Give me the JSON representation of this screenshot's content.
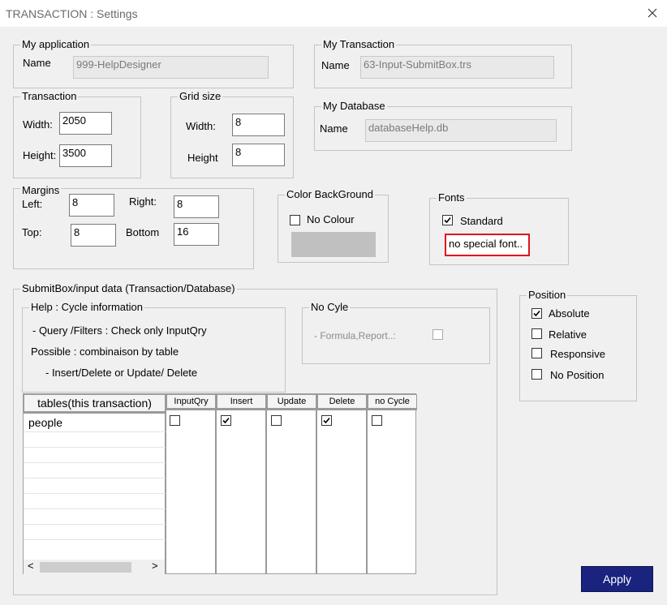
{
  "window": {
    "title": "TRANSACTION : Settings"
  },
  "my_application": {
    "legend": "My application",
    "name_label": "Name",
    "name_value": "999-HelpDesigner"
  },
  "my_transaction": {
    "legend": "My Transaction",
    "name_label": "Name",
    "name_value": "63-Input-SubmitBox.trs"
  },
  "my_database": {
    "legend": "My  Database",
    "name_label": "Name",
    "name_value": "databaseHelp.db"
  },
  "transaction": {
    "legend": "Transaction",
    "width_label": "Width:",
    "width_value": "2050",
    "height_label": "Height:",
    "height_value": "3500"
  },
  "grid_size": {
    "legend": "Grid size",
    "width_label": "Width:",
    "width_value": "8",
    "height_label": "Height",
    "height_value": "8"
  },
  "margins": {
    "legend": "Margins",
    "left_label": "Left:",
    "left_value": "8",
    "right_label": "Right:",
    "right_value": "8",
    "top_label": "Top:",
    "top_value": "8",
    "bottom_label": "Bottom",
    "bottom_value": "16"
  },
  "color_background": {
    "legend": "Color BackGround",
    "no_colour_label": "No Colour",
    "no_colour_checked": false,
    "swatch_color": "#c0c0c0"
  },
  "fonts": {
    "legend": "Fonts",
    "standard_label": "Standard",
    "standard_checked": true,
    "special_font_text": "no special font.."
  },
  "submitbox": {
    "legend": "SubmitBox/input data (Transaction/Database)",
    "help": {
      "legend": "Help : Cycle information",
      "line1": "- Query /Filters   : Check only InputQry",
      "line2": "Possible : combinaison by table",
      "line3": "- Insert/Delete or  Update/ Delete"
    },
    "no_cycle": {
      "legend": "No Cyle",
      "formula_label": "- Formula,Report..:",
      "formula_checked": false
    },
    "table": {
      "tables_header": "tables(this transaction)",
      "columns": [
        "InputQry",
        "Insert",
        "Update",
        "Delete",
        "no Cycle"
      ],
      "rows": [
        {
          "name": "people",
          "checks": [
            false,
            true,
            false,
            true,
            false
          ]
        }
      ]
    },
    "scroll_left": "<",
    "scroll_right": ">"
  },
  "position": {
    "legend": "Position",
    "options": [
      {
        "label": "Absolute",
        "checked": true
      },
      {
        "label": "Relative",
        "checked": false
      },
      {
        "label": "Responsive",
        "checked": false
      },
      {
        "label": "No Position",
        "checked": false
      }
    ]
  },
  "apply_label": "Apply"
}
